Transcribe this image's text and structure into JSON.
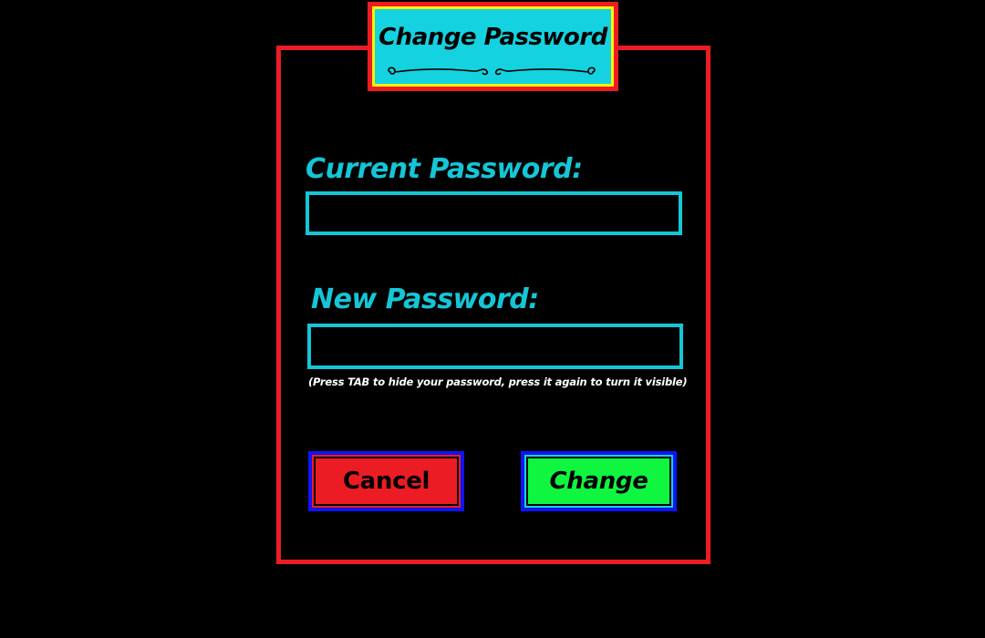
{
  "dialog": {
    "title": "Change Password",
    "current_password": {
      "label": "Current Password:",
      "value": "",
      "placeholder": ""
    },
    "new_password": {
      "label": "New Password:",
      "value": "",
      "placeholder": ""
    },
    "hint": "(Press TAB to hide your password, press it again to turn it visible)",
    "buttons": {
      "cancel_label": "Cancel",
      "change_label": "Change"
    }
  },
  "colors": {
    "background": "#000000",
    "frame": "#ec1c24",
    "title_bg": "#14d2e0",
    "title_ring": "#fff200",
    "accent_text": "#14c6d6",
    "cancel": "#ec1c24",
    "change": "#10f540",
    "button_border": "#0f14f5"
  }
}
